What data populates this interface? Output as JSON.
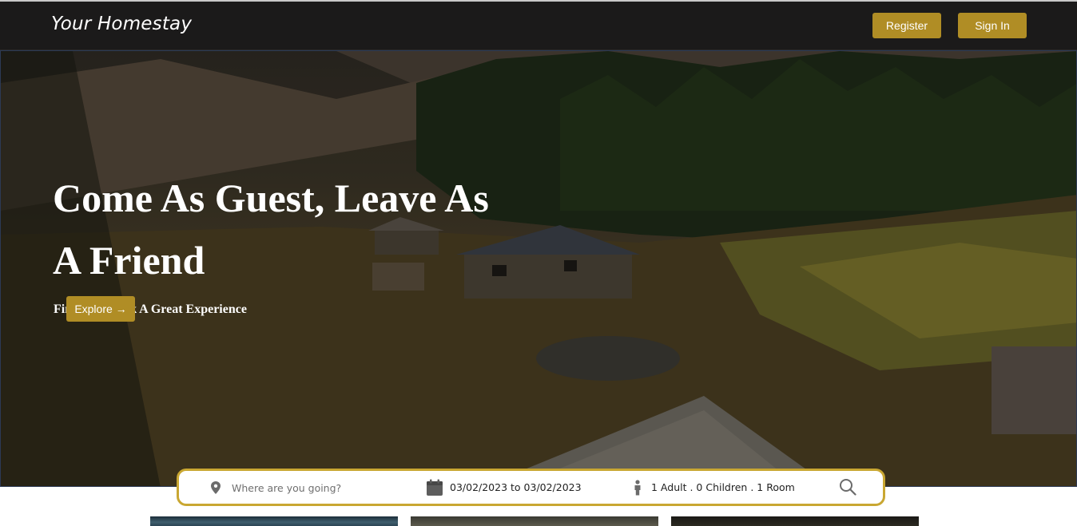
{
  "brand": {
    "name": "Your Homestay"
  },
  "nav": {
    "register_label": "Register",
    "signin_label": "Sign In"
  },
  "hero": {
    "title": "Come As Guest, Leave As A Friend",
    "subtitle": "Find And Book A Great Experience",
    "cta_label": "Explore →"
  },
  "search": {
    "destination_placeholder": "Where are you going?",
    "dates": "03/02/2023 to 03/02/2023",
    "guests": "1 Adult . 0 Children . 1 Room"
  },
  "icons": {
    "location": "map-pin-icon",
    "calendar": "calendar-icon",
    "guests": "person-icon",
    "search": "search-icon"
  },
  "colors": {
    "accent": "#b08d25",
    "navbar": "#1b1a1a",
    "search_border": "#c9a732"
  }
}
